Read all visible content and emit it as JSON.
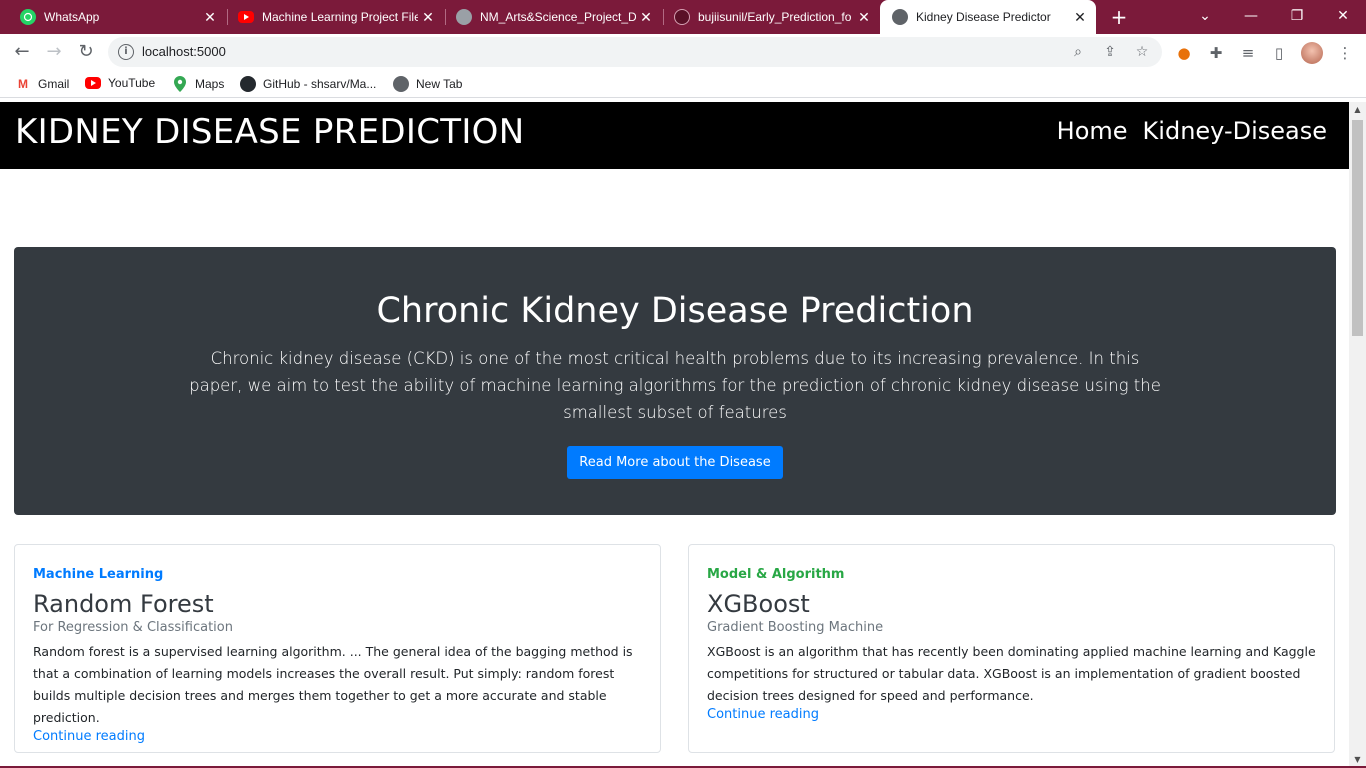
{
  "browser": {
    "tabs": [
      {
        "title": "WhatsApp",
        "icon": "whatsapp-icon"
      },
      {
        "title": "Machine Learning Project File",
        "icon": "youtube-icon"
      },
      {
        "title": "NM_Arts&Science_Project_Do",
        "icon": "globe-icon"
      },
      {
        "title": "bujiisunil/Early_Prediction_fo",
        "icon": "github-icon"
      },
      {
        "title": "Kidney Disease Predictor",
        "icon": "globe-icon",
        "active": true
      }
    ],
    "url": "localhost:5000",
    "bookmarks": [
      {
        "label": "Gmail",
        "icon": "gmail-icon"
      },
      {
        "label": "YouTube",
        "icon": "youtube-icon"
      },
      {
        "label": "Maps",
        "icon": "maps-icon"
      },
      {
        "label": "GitHub - shsarv/Ma...",
        "icon": "github-icon"
      },
      {
        "label": "New Tab",
        "icon": "globe-icon"
      }
    ],
    "colors": {
      "tabstrip": "#7b1a3a"
    }
  },
  "site": {
    "brand": "KIDNEY DISEASE PREDICTION",
    "nav": [
      "Home",
      "Kidney-Disease"
    ]
  },
  "hero": {
    "title": "Chronic Kidney Disease Prediction",
    "text": "Chronic kidney disease (CKD) is one of the most critical health problems due to its increasing prevalence. In this paper, we aim to test the ability of machine learning algorithms for the prediction of chronic kidney disease using the smallest subset of features",
    "button": "Read More about the Disease"
  },
  "cards": [
    {
      "category": "Machine Learning",
      "category_color": "#007bff",
      "title": "Random Forest",
      "subtitle": "For Regression & Classification",
      "description": "Random forest is a supervised learning algorithm. ... The general idea of the bagging method is that a combination of learning models increases the overall result. Put simply: random forest builds multiple decision trees and merges them together to get a more accurate and stable prediction.",
      "link": "Continue reading"
    },
    {
      "category": "Model & Algorithm",
      "category_color": "#28a745",
      "title": "XGBoost",
      "subtitle": "Gradient Boosting Machine",
      "description": "XGBoost is an algorithm that has recently been dominating applied machine learning and Kaggle competitions for structured or tabular data. XGBoost is an implementation of gradient boosted decision trees designed for speed and performance.",
      "link": "Continue reading"
    }
  ]
}
